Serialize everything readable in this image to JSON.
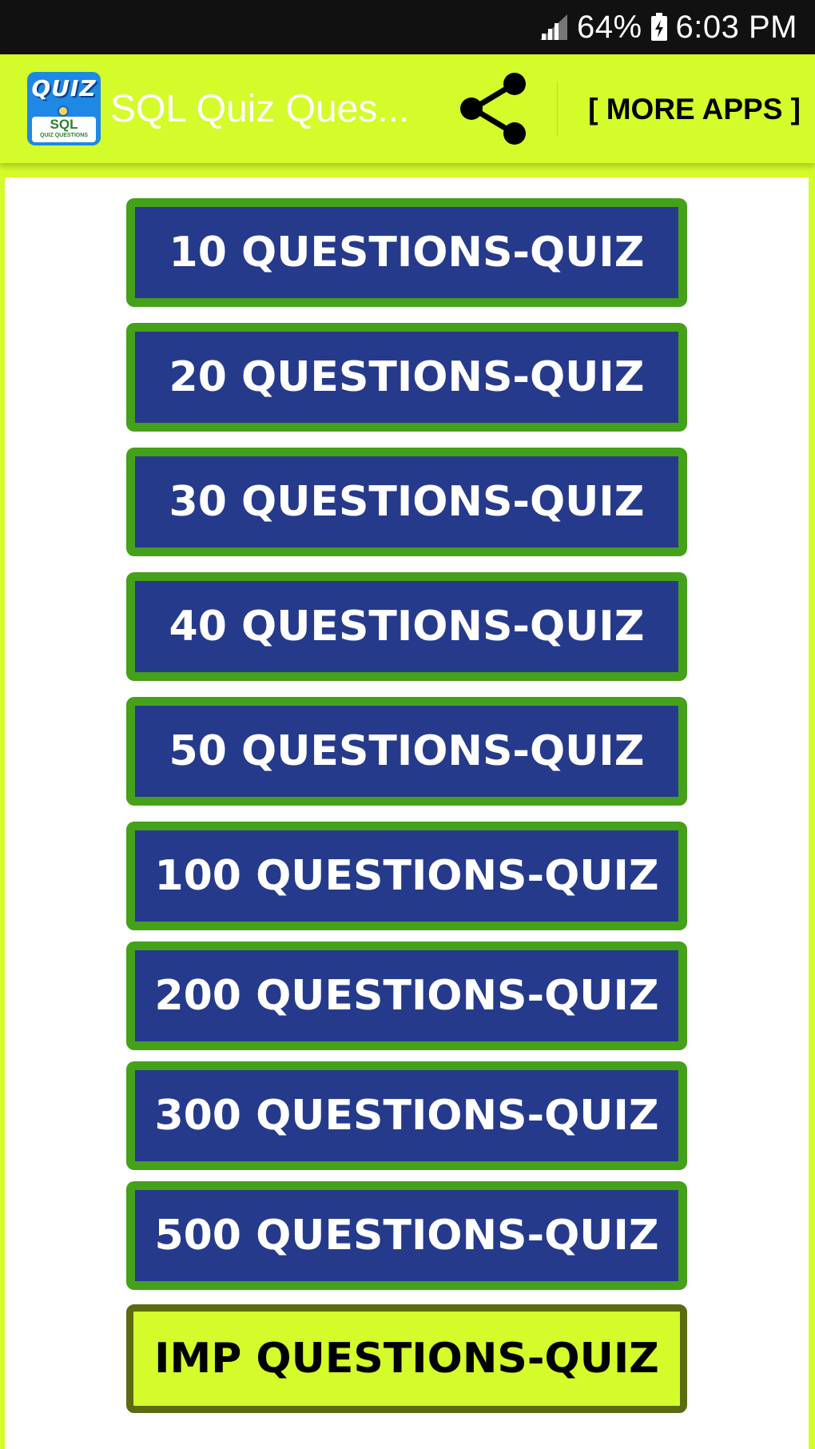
{
  "status_bar": {
    "battery_percent": "64%",
    "time": "6:03 PM",
    "signal_icon": "signal-icon",
    "battery_icon": "battery-icon"
  },
  "app_bar": {
    "logo": {
      "quiz_text": "QUIZ",
      "sql_text": "SQL",
      "sub_text": "QUIZ QUESTIONS"
    },
    "title": "SQL Quiz Ques...",
    "share_icon": "share-icon",
    "more_apps_label": "[ MORE APPS ]"
  },
  "quiz_buttons": [
    {
      "label": "10 QUESTIONS-QUIZ"
    },
    {
      "label": "20 QUESTIONS-QUIZ"
    },
    {
      "label": "30 QUESTIONS-QUIZ"
    },
    {
      "label": "40 QUESTIONS-QUIZ"
    },
    {
      "label": "50 QUESTIONS-QUIZ"
    },
    {
      "label": "100 QUESTIONS-QUIZ"
    },
    {
      "label": "200 QUESTIONS-QUIZ"
    },
    {
      "label": "300 QUESTIONS-QUIZ"
    },
    {
      "label": "500 QUESTIONS-QUIZ"
    },
    {
      "label": "IMP QUESTIONS-QUIZ"
    }
  ],
  "colors": {
    "app_bar": "#d4fb2a",
    "button_fill": "#263a8c",
    "button_border": "#45a01a",
    "imp_button_fill": "#d4fb2a",
    "imp_button_border": "#5a6b12",
    "status_bar": "#111111"
  }
}
